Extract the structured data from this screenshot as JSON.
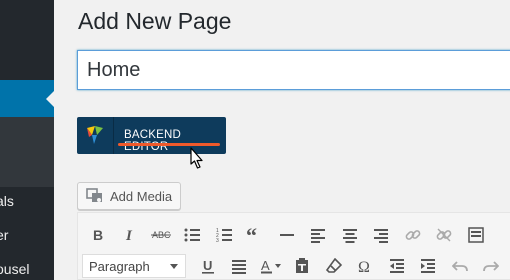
{
  "sidebar": {
    "items": [
      {
        "label": "als"
      },
      {
        "label": "er"
      },
      {
        "label": "ousel"
      }
    ]
  },
  "page": {
    "title": "Add New Page",
    "title_value": "Home"
  },
  "backend_editor": {
    "label": "BACKEND EDITOR",
    "underline_color": "#f05a2b",
    "bg_color": "#0e3b5c"
  },
  "media": {
    "add_label": "Add Media"
  },
  "toolbar": {
    "format_select": "Paragraph",
    "row1_icons": [
      "bold-icon",
      "italic-icon",
      "strikethrough-icon",
      "bullet-list-icon",
      "numbered-list-icon",
      "blockquote-icon",
      "horizontal-line-icon",
      "align-left-icon",
      "align-center-icon",
      "align-right-icon",
      "insert-link-icon",
      "remove-link-icon",
      "toolbar-toggle-icon"
    ],
    "row2_icons": [
      "underline-icon",
      "justify-icon",
      "text-color-icon",
      "paste-text-icon",
      "clear-formatting-icon",
      "special-character-icon",
      "outdent-icon",
      "indent-icon",
      "undo-icon",
      "redo-icon"
    ]
  },
  "colors": {
    "sidebar": "#23282d",
    "active": "#0073aa",
    "accent": "#f05a2b"
  }
}
